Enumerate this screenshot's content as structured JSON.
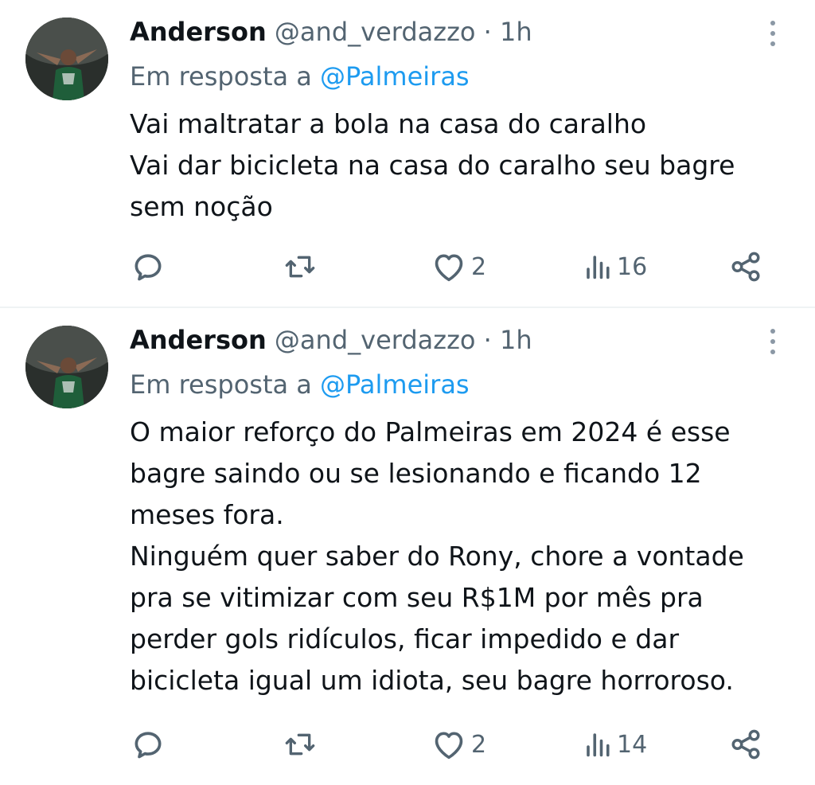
{
  "tweets": [
    {
      "author_name": "Anderson",
      "handle": "@and_verdazzo",
      "separator": "·",
      "time": "1h",
      "reply_prefix": "Em resposta a",
      "reply_to": "@Palmeiras",
      "lines": [
        "Vai maltratar a bola na casa do caralho",
        "Vai dar bicicleta na casa do caralho seu bagre",
        "sem noção"
      ],
      "likes": "2",
      "views": "16"
    },
    {
      "author_name": "Anderson",
      "handle": "@and_verdazzo",
      "separator": "·",
      "time": "1h",
      "reply_prefix": "Em resposta a",
      "reply_to": "@Palmeiras",
      "lines": [
        "O maior reforço do Palmeiras em 2024 é esse",
        "bagre saindo ou se lesionando e ficando 12",
        "meses fora.",
        "Ninguém quer saber do Rony, chore a vontade",
        "pra se vitimizar com seu R$1M por mês pra",
        "perder gols ridículos, ficar impedido e dar",
        "bicicleta igual um idiota, seu bagre horroroso."
      ],
      "likes": "2",
      "views": "14"
    }
  ],
  "icons": {
    "reply": "reply-icon",
    "retweet": "retweet-icon",
    "like": "heart-icon",
    "views": "views-icon",
    "share": "share-icon",
    "more": "more-options-icon"
  },
  "colors": {
    "text": "#0f1419",
    "secondary": "#536471",
    "link": "#1d9bf0",
    "divider": "#eff3f4"
  }
}
